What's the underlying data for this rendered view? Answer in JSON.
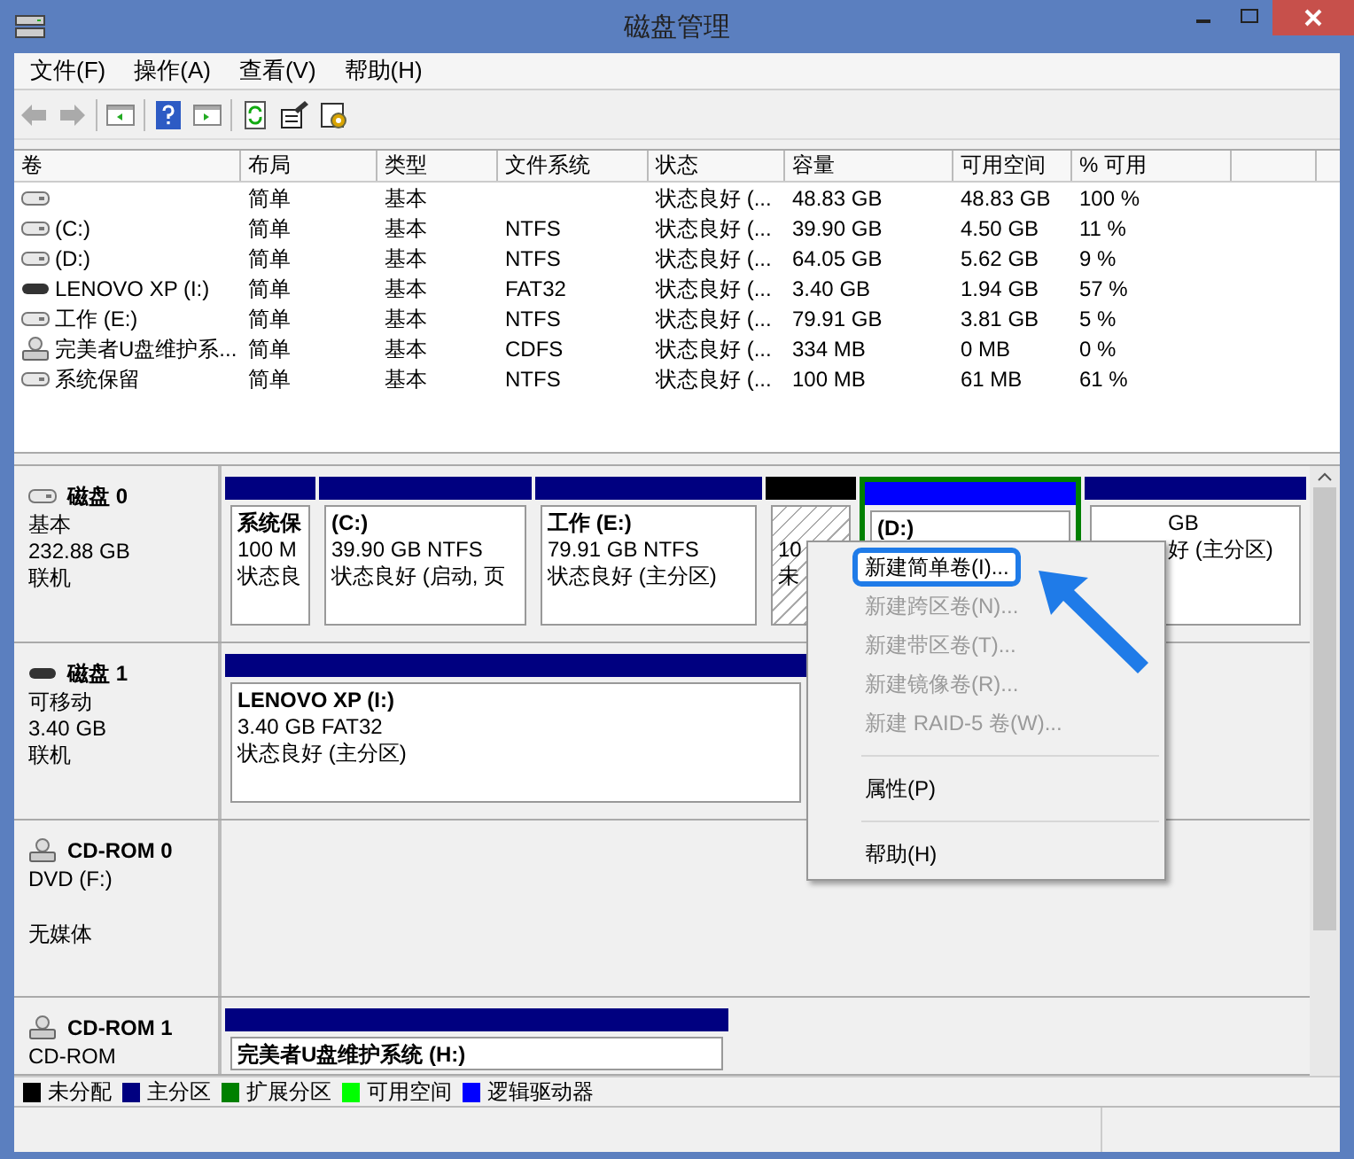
{
  "window": {
    "title": "磁盘管理"
  },
  "menu": [
    "文件(F)",
    "操作(A)",
    "查看(V)",
    "帮助(H)"
  ],
  "table": {
    "columns": [
      "卷",
      "布局",
      "类型",
      "文件系统",
      "状态",
      "容量",
      "可用空间",
      "% 可用"
    ],
    "rows": [
      {
        "kind": "disk",
        "cells": [
          "",
          "简单",
          "基本",
          "",
          "状态良好 (...",
          "48.83 GB",
          "48.83 GB",
          "100 %"
        ]
      },
      {
        "kind": "disk",
        "cells": [
          "(C:)",
          "简单",
          "基本",
          "NTFS",
          "状态良好 (...",
          "39.90 GB",
          "4.50 GB",
          "11 %"
        ]
      },
      {
        "kind": "disk",
        "cells": [
          "(D:)",
          "简单",
          "基本",
          "NTFS",
          "状态良好 (...",
          "64.05 GB",
          "5.62 GB",
          "9 %"
        ]
      },
      {
        "kind": "usb",
        "cells": [
          "LENOVO XP (I:)",
          "简单",
          "基本",
          "FAT32",
          "状态良好 (...",
          "3.40 GB",
          "1.94 GB",
          "57 %"
        ]
      },
      {
        "kind": "disk",
        "cells": [
          "工作 (E:)",
          "简单",
          "基本",
          "NTFS",
          "状态良好 (...",
          "79.91 GB",
          "3.81 GB",
          "5 %"
        ]
      },
      {
        "kind": "cd",
        "cells": [
          "完美者U盘维护系...",
          "简单",
          "基本",
          "CDFS",
          "状态良好 (...",
          "334 MB",
          "0 MB",
          "0 %"
        ]
      },
      {
        "kind": "disk",
        "cells": [
          "系统保留",
          "简单",
          "基本",
          "NTFS",
          "状态良好 (...",
          "100 MB",
          "61 MB",
          "61 %"
        ]
      }
    ]
  },
  "disks": [
    {
      "kind": "disk",
      "name": "磁盘 0",
      "lines": [
        "基本",
        "232.88 GB",
        "联机"
      ],
      "partitions": [
        {
          "kind": "primary",
          "name": "系统保",
          "lines": [
            "100 M",
            "状态良"
          ],
          "selected": false
        },
        {
          "kind": "primary",
          "name": "(C:)",
          "lines": [
            "39.90 GB NTFS",
            "状态良好 (启动, 页"
          ],
          "selected": false
        },
        {
          "kind": "primary",
          "name": "工作 (E:)",
          "lines": [
            "79.91 GB NTFS",
            "状态良好 (主分区)"
          ],
          "selected": false
        },
        {
          "kind": "unallocated",
          "lines": [
            "10",
            "未"
          ],
          "selected": true
        },
        {
          "kind": "logical",
          "name": "(D:)",
          "selected": false
        },
        {
          "kind": "primary",
          "lines": [
            "GB",
            "好 (主分区)"
          ],
          "selected": false
        }
      ]
    },
    {
      "kind": "usb",
      "name": "磁盘 1",
      "lines": [
        "可移动",
        "3.40 GB",
        "联机"
      ],
      "partitions": [
        {
          "kind": "primary",
          "name": "LENOVO XP (I:)",
          "lines": [
            "3.40 GB FAT32",
            "状态良好 (主分区)"
          ],
          "selected": false
        }
      ]
    },
    {
      "kind": "cd",
      "name": "CD-ROM 0",
      "lines": [
        "DVD (F:)"
      ],
      "status": "无媒体"
    },
    {
      "kind": "cd",
      "name": "CD-ROM 1",
      "lines": [
        "CD-ROM"
      ],
      "partitions": [
        {
          "kind": "primary",
          "name": "完美者U盘维护系统 (H:)",
          "selected": false
        }
      ]
    }
  ],
  "legend": [
    {
      "label": "未分配",
      "color": "#000000"
    },
    {
      "label": "主分区",
      "color": "#000080"
    },
    {
      "label": "扩展分区",
      "color": "#008000"
    },
    {
      "label": "可用空间",
      "color": "#00ff00"
    },
    {
      "label": "逻辑驱动器",
      "color": "#0000ff"
    }
  ],
  "context_menu": [
    {
      "kind": "item",
      "label": "新建简单卷(I)...",
      "disabled": false,
      "highlighted": true
    },
    {
      "kind": "item",
      "label": "新建跨区卷(N)...",
      "disabled": true,
      "highlighted": false
    },
    {
      "kind": "item",
      "label": "新建带区卷(T)...",
      "disabled": true,
      "highlighted": false
    },
    {
      "kind": "item",
      "label": "新建镜像卷(R)...",
      "disabled": true,
      "highlighted": false
    },
    {
      "kind": "item",
      "label": "新建 RAID-5 卷(W)...",
      "disabled": true,
      "highlighted": false
    },
    {
      "kind": "separator"
    },
    {
      "kind": "item",
      "label": "属性(P)",
      "disabled": false,
      "highlighted": false
    },
    {
      "kind": "separator"
    },
    {
      "kind": "item",
      "label": "帮助(H)",
      "disabled": false,
      "highlighted": false
    }
  ]
}
